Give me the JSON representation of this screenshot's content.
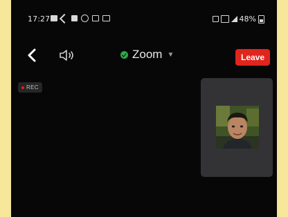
{
  "status_bar": {
    "time": "17:27",
    "battery_percent": "48%",
    "left_icons": [
      "photo-icon",
      "call-icon",
      "video-icon",
      "settings-icon",
      "gallery-icon",
      "mail-icon"
    ],
    "right_icons": [
      "mute-icon",
      "wifi-icon",
      "signal-icon",
      "battery-icon"
    ]
  },
  "meeting": {
    "title": "Zoom",
    "encrypted_color": "#2ea84a",
    "leave_label": "Leave",
    "leave_color": "#e0251d",
    "recording_label": "REC"
  },
  "participant": {
    "video_on": true
  }
}
